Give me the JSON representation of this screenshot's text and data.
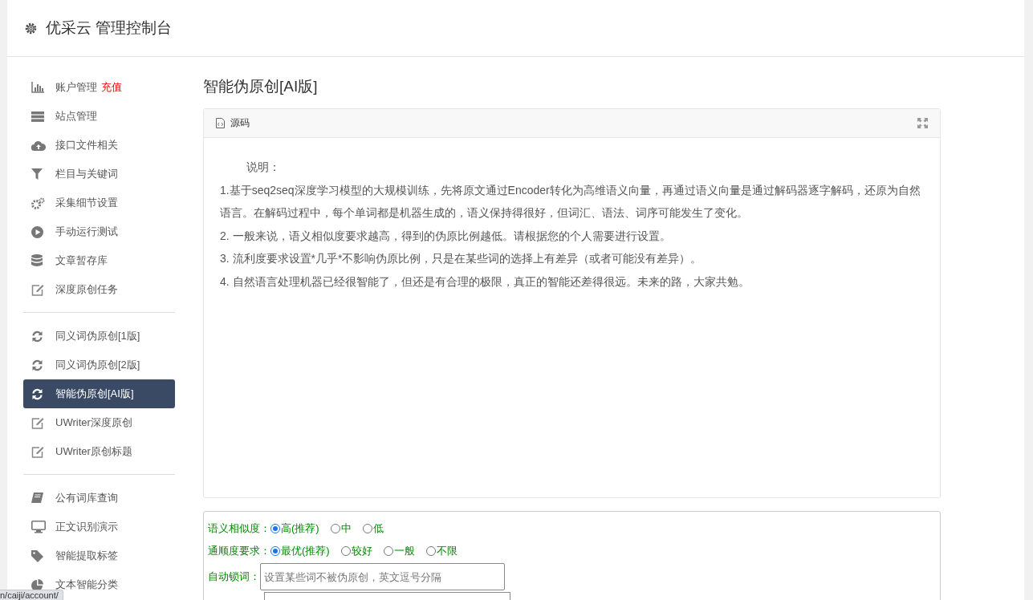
{
  "header": {
    "title": "优采云 管理控制台"
  },
  "sidebar": {
    "sections": [
      {
        "items": [
          {
            "label": "账户管理",
            "badge": "充值",
            "kind": "chart",
            "selected": false
          },
          {
            "label": "站点管理",
            "kind": "server",
            "selected": false
          },
          {
            "label": "接口文件相关",
            "kind": "cloud",
            "selected": false
          },
          {
            "label": "栏目与关键词",
            "kind": "filter",
            "selected": false
          },
          {
            "label": "采集细节设置",
            "kind": "gears",
            "selected": false
          },
          {
            "label": "手动运行测试",
            "kind": "play",
            "selected": false
          },
          {
            "label": "文章暂存库",
            "kind": "database",
            "selected": false
          },
          {
            "label": "深度原创任务",
            "kind": "edit",
            "selected": false
          }
        ]
      },
      {
        "items": [
          {
            "label": "同义词伪原创[1版]",
            "kind": "refresh",
            "selected": false
          },
          {
            "label": "同义词伪原创[2版]",
            "kind": "refresh",
            "selected": false
          },
          {
            "label": "智能伪原创[AI版]",
            "kind": "refresh",
            "selected": true
          },
          {
            "label": "UWriter深度原创",
            "kind": "edit",
            "selected": false
          },
          {
            "label": "UWriter原创标题",
            "kind": "edit",
            "selected": false
          }
        ]
      },
      {
        "items": [
          {
            "label": "公有词库查询",
            "kind": "book",
            "selected": false
          },
          {
            "label": "正文识别演示",
            "kind": "monitor",
            "selected": false
          },
          {
            "label": "智能提取标签",
            "kind": "tag",
            "selected": false
          },
          {
            "label": "文本智能分类",
            "kind": "pie",
            "selected": false
          }
        ]
      }
    ]
  },
  "main": {
    "title": "智能伪原创[AI版]",
    "panel": {
      "heading": "源码",
      "paragraphs": [
        "说明：",
        "1.基于seq2seq深度学习模型的大规模训练，先将原文通过Encoder转化为高维语义向量，再通过语义向量是通过解码器逐字解码，还原为自然语言。在解码过程中，每个单词都是机器生成的，语义保持得很好，但词汇、语法、词序可能发生了变化。",
        "2. 一般来说，语义相似度要求越高，得到的伪原比例越低。请根据您的个人需要进行设置。",
        "3. 流利度要求设置*几乎*不影响伪原比例，只是在某些词的选择上有差异（或者可能没有差异）。",
        "4. 自然语言处理机器已经很智能了，但还是有合理的极限，真正的智能还差得很远。未来的路，大家共勉。"
      ]
    },
    "form": {
      "rows": [
        {
          "label": "语义相似度：",
          "kind": "radio",
          "options": [
            {
              "label": "高(推荐)",
              "selected": true
            },
            {
              "label": "中",
              "selected": false
            },
            {
              "label": "低",
              "selected": false
            }
          ]
        },
        {
          "label": "通顺度要求：",
          "kind": "radio",
          "options": [
            {
              "label": "最优(推荐)",
              "selected": true
            },
            {
              "label": "较好",
              "selected": false
            },
            {
              "label": "一般",
              "selected": false
            },
            {
              "label": "不限",
              "selected": false
            }
          ]
        },
        {
          "label": "自动锁词：",
          "kind": "text",
          "placeholder": "设置某些词不被伪原创，英文逗号分隔"
        }
      ]
    }
  },
  "status_bar": {
    "url": "n/caiji/account/"
  }
}
